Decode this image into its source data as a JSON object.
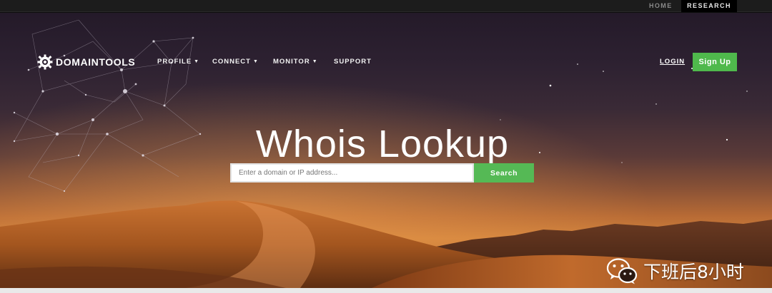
{
  "topbar": {
    "home": "HOME",
    "research": "RESEARCH"
  },
  "brand": {
    "name": "DOMAINTOOLS"
  },
  "nav": {
    "profile": "PROFILE",
    "connect": "CONNECT",
    "monitor": "MONITOR",
    "support": "SUPPORT",
    "login": "LOGIN",
    "signup": "Sign Up"
  },
  "hero": {
    "title": "Whois Lookup",
    "search_placeholder": "Enter a domain or IP address...",
    "search_button": "Search"
  },
  "watermark": {
    "text": "下班后8小时"
  },
  "colors": {
    "accent_green": "#4fb94c",
    "topbar": "#1c1c1c"
  },
  "icons": {
    "logo": "domaintools-gear-icon",
    "caret": "caret-down-icon",
    "watermark": "wechat-icon"
  }
}
